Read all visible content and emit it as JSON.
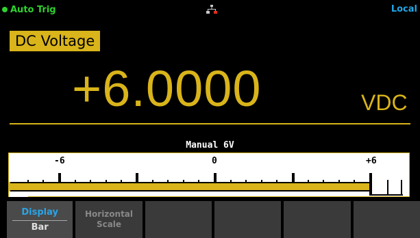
{
  "status": {
    "trigger": "Auto Trig",
    "remote": "Local",
    "network_icon": "network-lan-icon"
  },
  "function": "DC Voltage",
  "reading": {
    "value": "+6.0000",
    "unit": "VDC"
  },
  "range": "Manual 6V",
  "bar": {
    "min_label": "-6",
    "mid_label": "0",
    "max_label": "+6",
    "fill_fraction": 1.0
  },
  "softkeys": [
    {
      "title": "Display",
      "value": "Bar"
    },
    {
      "title": "Horizontal Scale"
    },
    {
      "title": ""
    },
    {
      "title": ""
    },
    {
      "title": ""
    },
    {
      "title": ""
    }
  ],
  "colors": {
    "accent": "#d9b41a",
    "trigger": "#2fd12f",
    "local": "#22a6e6"
  }
}
